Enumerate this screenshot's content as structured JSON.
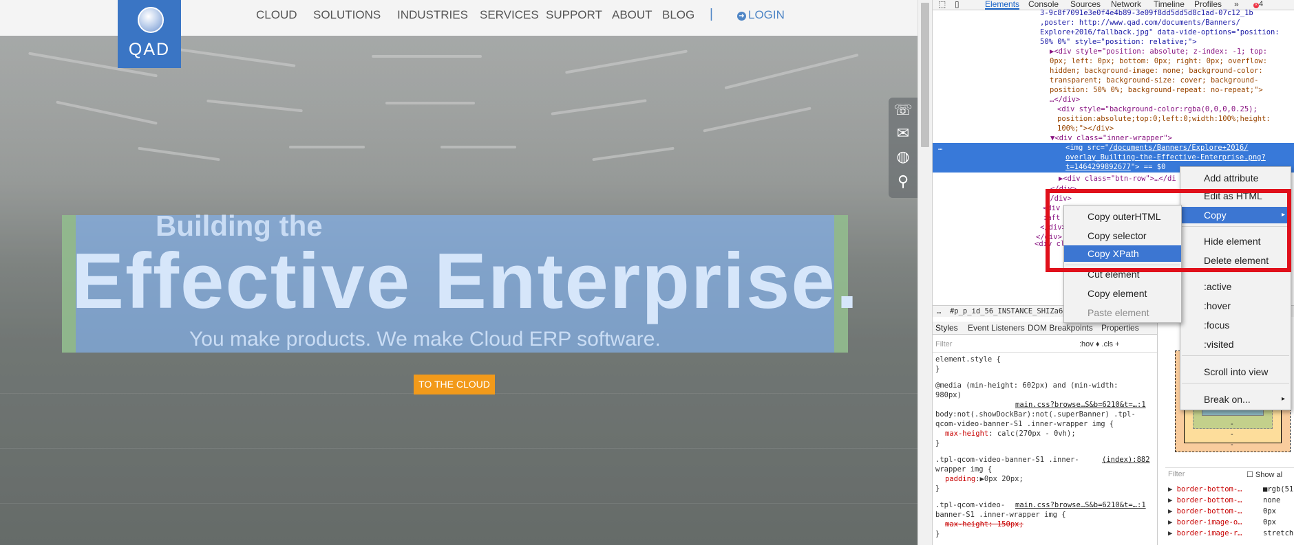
{
  "site": {
    "logo_text": "QAD",
    "nav": [
      "CLOUD",
      "SOLUTIONS",
      "INDUSTRIES",
      "SERVICES",
      "SUPPORT",
      "ABOUT",
      "BLOG"
    ],
    "nav_separator": "|",
    "login_label": "LOGIN",
    "login_icon": "arrow-circle-icon",
    "side_icons": [
      "phone-icon",
      "mail-icon",
      "globe-icon",
      "search-icon"
    ],
    "hero": {
      "line1": "Building the",
      "line2": "Effective Enterprise.",
      "line3": "You make products. We make Cloud ERP software."
    },
    "cta_label": "TO THE CLOUD",
    "colors": {
      "brand_blue": "#3a75c4",
      "cta_orange": "#f29a1a",
      "link_blue": "#4f86c6"
    }
  },
  "devtools": {
    "toolbar": {
      "inspect_icon": "cursor-icon",
      "device_icon": "device-icon",
      "tabs": [
        "Elements",
        "Console",
        "Sources",
        "Network",
        "Timeline",
        "Profiles"
      ],
      "more": "»",
      "errors": "4"
    },
    "dom": {
      "l0": "3-9c8f7091e3e0f4e4b89-3e09f8dd5dd5d8c1ad-07c12_1b",
      "l1": ",poster: http://www.qad.com/documents/Banners/",
      "l2": "Explore+2016/fallback.jpg\" data-vide-options=\"position:",
      "l3": "50% 0%\" style=\"position: relative;\">",
      "l4": "▶<div style=\"position: absolute; z-index: -1; top:",
      "l5": "0px; left: 0px; bottom: 0px; right: 0px; overflow:",
      "l6": "hidden; background-image: none; background-color:",
      "l7": "transparent; background-size: cover; background-",
      "l8": "position: 50% 0%; background-repeat: no-repeat;\">",
      "l9": "…</div>",
      "l10": "<div style=\"background-color:rgba(0,0,0,0.25);",
      "l11": "position:absolute;top:0;left:0;width:100%;height:",
      "l12": "100%;\"></div>",
      "l13": "▼<div class=\"inner-wrapper\">",
      "sel1a": "<img src=\"",
      "sel1b": "/documents/Banners/Explore+2016/",
      "sel2": "overlay_Builting-the-Effective-Enterprise.png?",
      "sel3a": "t=1464299892677",
      "sel3b": "\"> == $0",
      "ellipsis": "…",
      "l14": "▶<div class=\"btn-row\">…</di",
      "l15": "</div>",
      "l16": "</div>",
      "l17": "<div",
      "l18": ":aft",
      "l19": "</div>",
      "l20": "</div>",
      "l21": "<div cl"
    },
    "breadcrumb": "…  #p_p_id_56_INSTANCE_SHIZa6i8",
    "subtabs": [
      "Styles",
      "Event Listeners",
      "DOM Breakpoints",
      "Properties"
    ],
    "filter": {
      "placeholder": "Filter",
      "ops": ":hov  ♦  .cls  +"
    },
    "styles": {
      "s1": "element.style {",
      "s2": "}",
      "s3": "@media (min-height: 602px) and (min-width:",
      "s4": "980px)",
      "s5_link": "main.css?browse…S&b=6210&t=…:1",
      "s6": "body:not(.showDockBar):not(.superBanner) .tpl-",
      "s7": "qcom-video-banner-S1 .inner-wrapper img {",
      "s8_prop": "max-height",
      "s8_val": ": calc(270px - 0vh);",
      "s9": "}",
      "s10": ".tpl-qcom-video-banner-S1 .inner-",
      "s10_link": "(index):882",
      "s11": "wrapper img {",
      "s12_prop": "padding",
      "s12_val": ":▶0px 20px;",
      "s13": "}",
      "s14": ".tpl-qcom-video-",
      "s14_link": "main.css?browse…S&b=6210&t=…:1",
      "s15": "banner-S1 .inner-wrapper img {",
      "s16": "max-height: 150px;",
      "s17": "}"
    },
    "boxmodel": {
      "dash1": "-",
      "dash2": "-",
      "dash3": "-",
      "dash4": "-"
    },
    "computed_filter": {
      "placeholder": "Filter",
      "show_all": "Show al"
    },
    "computed": [
      {
        "p": "border-bottom-…",
        "v": "rgb(51"
      },
      {
        "p": "border-bottom-…",
        "v": "none"
      },
      {
        "p": "border-bottom-…",
        "v": "0px"
      },
      {
        "p": "border-image-o…",
        "v": "0px"
      },
      {
        "p": "border-image-r…",
        "v": "stretch"
      }
    ]
  },
  "context_menu_main": {
    "items": [
      "Add attribute",
      "Edit as HTML",
      "Copy",
      "Hide element",
      "Delete element",
      ":active",
      ":hover",
      ":focus",
      ":visited",
      "Scroll into view",
      "Break on..."
    ],
    "submenu_arrow": "▸"
  },
  "context_menu_copy": {
    "items": [
      "Copy outerHTML",
      "Copy selector",
      "Copy XPath",
      "Cut element",
      "Copy element",
      "Paste element"
    ]
  }
}
